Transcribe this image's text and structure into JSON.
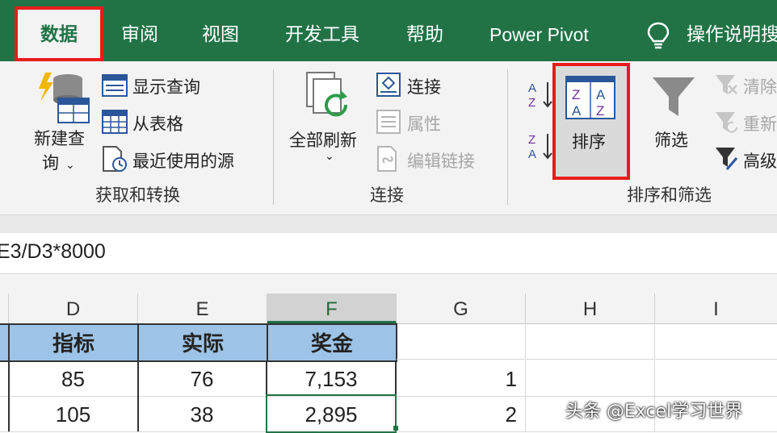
{
  "tabs": {
    "data": "数据",
    "review": "审阅",
    "view": "视图",
    "developer": "开发工具",
    "help": "帮助",
    "powerpivot": "Power Pivot",
    "tellme": "操作说明搜"
  },
  "ribbon": {
    "get_transform": {
      "new_query_line1": "新建查",
      "new_query_line2": "询",
      "show_queries": "显示查询",
      "from_table": "从表格",
      "recent_sources": "最近使用的源",
      "label": "获取和转换"
    },
    "connections": {
      "refresh_all": "全部刷新",
      "connections": "连接",
      "properties": "属性",
      "edit_links": "编辑链接",
      "label": "连接"
    },
    "sort_filter": {
      "sort": "排序",
      "filter": "筛选",
      "clear": "清除",
      "reapply": "重新",
      "advanced": "高级",
      "label": "排序和筛选"
    }
  },
  "formula_bar": {
    "text": "E3/D3*8000"
  },
  "columns": [
    "D",
    "E",
    "F",
    "G",
    "H",
    "I"
  ],
  "table": {
    "headers": [
      "指标",
      "实际",
      "奖金"
    ],
    "rows": [
      {
        "d": "85",
        "e": "76",
        "f": "7,153",
        "g": "1"
      },
      {
        "d": "105",
        "e": "38",
        "f": "2,895",
        "g": "2"
      }
    ]
  },
  "watermark": "头条 @Excel学习世界",
  "colors": {
    "excel_green": "#217346",
    "highlight_red": "#e81c1c",
    "header_fill": "#9dc3e6"
  }
}
